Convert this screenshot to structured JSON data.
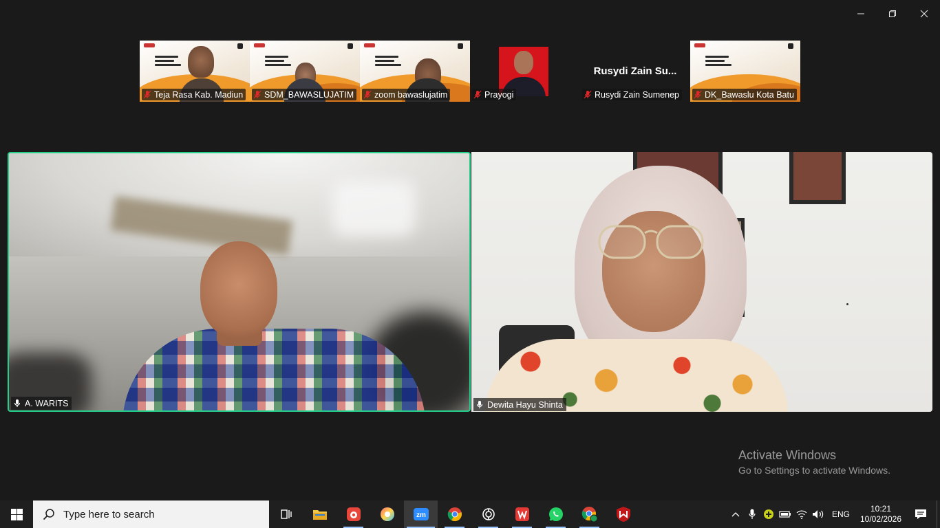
{
  "window": {
    "minimize_icon": "minimize-icon",
    "restore_icon": "restore-icon",
    "close_icon": "close-icon"
  },
  "thumbnails": [
    {
      "name": "Teja Rasa Kab. Madiun",
      "type": "video-slide"
    },
    {
      "name": "SDM_BAWASLUJATIM",
      "type": "video-slide"
    },
    {
      "name": "zoom bawaslujatim",
      "type": "video-slide"
    },
    {
      "name": "Prayogi",
      "type": "photo"
    },
    {
      "name": "Rusydi Zain Sumenep",
      "display_name": "Rusydi  Zain  Su...",
      "type": "no-video"
    },
    {
      "name": "DK_Bawaslu Kota Batu",
      "type": "slide"
    }
  ],
  "main": {
    "left": {
      "name": "A. WARITS",
      "active_speaker": true
    },
    "right": {
      "name": "Dewita Hayu Shinta"
    }
  },
  "watermark": {
    "line1": "Activate Windows",
    "line2": "Go to Settings to activate Windows."
  },
  "taskbar": {
    "search_placeholder": "Type here to search",
    "apps": [
      "task-view-icon",
      "file-explorer-icon",
      "app-red-icon",
      "photos-icon",
      "zoom-icon",
      "chrome-icon",
      "chatgpt-icon",
      "wps-icon",
      "whatsapp-icon",
      "chrome-profile-icon",
      "mcafee-icon"
    ],
    "active_app": "zoom-icon",
    "language": "ENG",
    "time": "10:21",
    "date": "10/02/2026"
  },
  "colors": {
    "active_speaker_border": "#23d18b",
    "background": "#1a1a1a",
    "taskbar": "#1f1f1f"
  }
}
